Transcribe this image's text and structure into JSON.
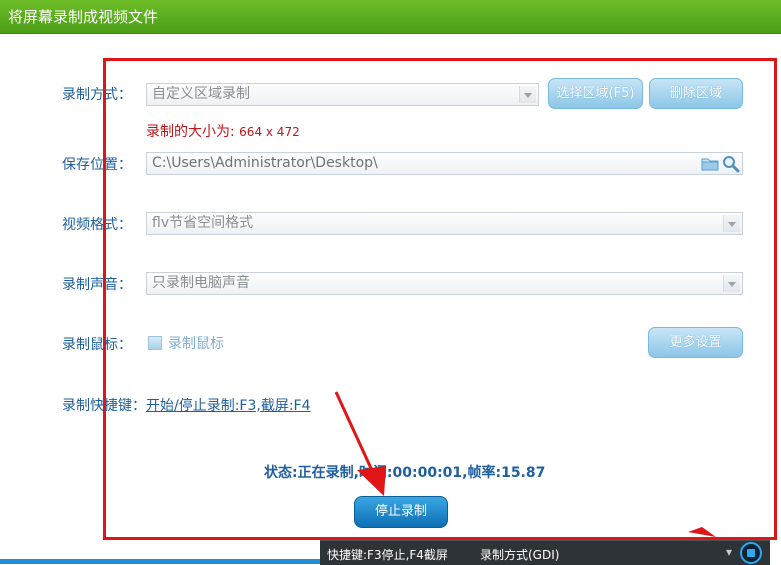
{
  "window": {
    "title": "将屏幕录制成视频文件"
  },
  "form": {
    "record_mode": {
      "label": "录制方式：",
      "value": "自定义区域录制",
      "select_button": "选择区域(F5)",
      "delete_button": "删除区域"
    },
    "record_size": {
      "prefix": "录制的大小为: ",
      "value": "664 x 472"
    },
    "save_location": {
      "label": "保存位置：",
      "value": "C:\\Users\\Administrator\\Desktop\\"
    },
    "video_format": {
      "label": "视频格式：",
      "value": "flv节省空间格式"
    },
    "record_audio": {
      "label": "录制声音：",
      "value": "只录制电脑声音"
    },
    "record_mouse": {
      "label": "录制鼠标：",
      "checkbox_label": "录制鼠标",
      "checked": false,
      "more_button": "更多设置"
    },
    "hotkeys": {
      "label": "录制快捷键：",
      "value": "开始/停止录制:F3,截屏:F4"
    }
  },
  "status": {
    "text": "状态:正在录制,时间:00:00:01,帧率:15.87"
  },
  "stop_button": {
    "label": "停止录制"
  },
  "taskbar": {
    "hotkeys": "快捷键:F3停止,F4截屏",
    "mode": "录制方式(GDI)",
    "chevron": "▾"
  },
  "icons": {
    "folder": "folder-icon",
    "search": "search-icon",
    "stop": "stop-record-icon"
  },
  "colors": {
    "title_green": "#5aad1f",
    "highlight_red": "#e01515",
    "label_blue": "#1f5fa0",
    "button_blue": "#1679c4"
  }
}
